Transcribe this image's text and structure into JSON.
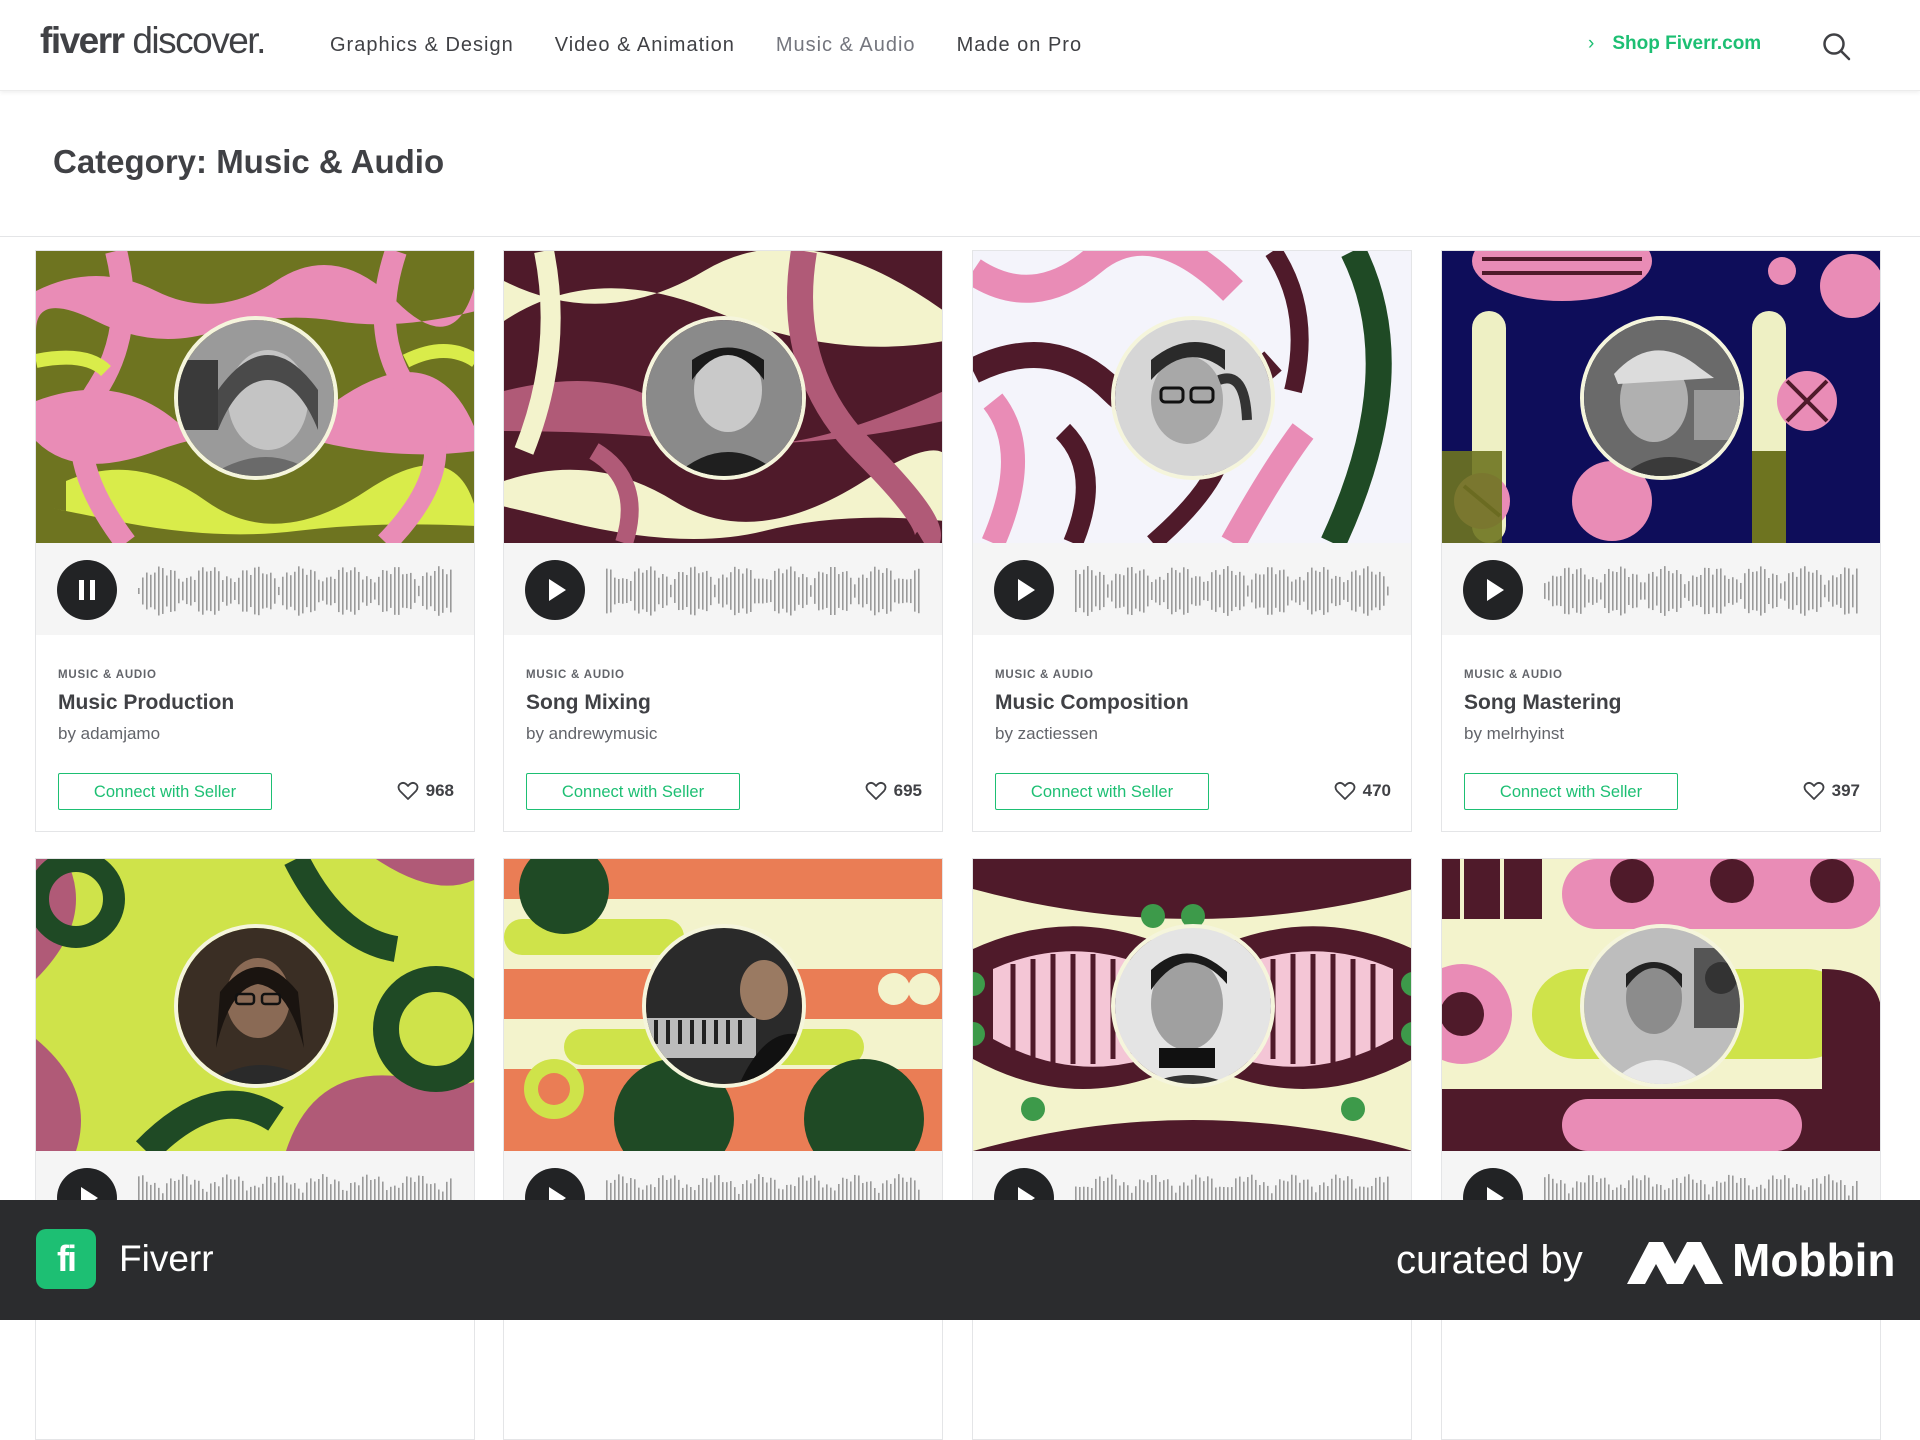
{
  "header": {
    "logo_brand": "fiverr",
    "logo_suffix": " discover.",
    "nav": [
      "Graphics & Design",
      "Video & Animation",
      "Music & Audio",
      "Made on Pro"
    ],
    "active_nav": "Music & Audio",
    "shop_link": "Shop Fiverr.com",
    "search_icon": "search-icon"
  },
  "page": {
    "title": "Category: Music & Audio"
  },
  "cards": [
    {
      "category": "MUSIC & AUDIO",
      "title": "Music Production",
      "seller": "by adamjamo",
      "cta": "Connect with Seller",
      "likes": "968",
      "state": "playing"
    },
    {
      "category": "MUSIC & AUDIO",
      "title": "Song Mixing",
      "seller": "by andrewymusic",
      "cta": "Connect with Seller",
      "likes": "695",
      "state": "paused"
    },
    {
      "category": "MUSIC & AUDIO",
      "title": "Music Composition",
      "seller": "by zactiessen",
      "cta": "Connect with Seller",
      "likes": "470",
      "state": "paused"
    },
    {
      "category": "MUSIC & AUDIO",
      "title": "Song Mastering",
      "seller": "by melrhyinst",
      "cta": "Connect with Seller",
      "likes": "397",
      "state": "paused"
    },
    {
      "state": "paused"
    },
    {
      "state": "paused"
    },
    {
      "state": "paused"
    },
    {
      "state": "paused"
    }
  ],
  "footer": {
    "app_name": "Fiverr",
    "app_icon_glyph": "fi",
    "curated_by": "curated by",
    "mobbin": "Mobbin"
  },
  "colors": {
    "brand_green": "#1dbf73",
    "text_dark": "#404145",
    "footer_bg": "#2b2c2e"
  }
}
